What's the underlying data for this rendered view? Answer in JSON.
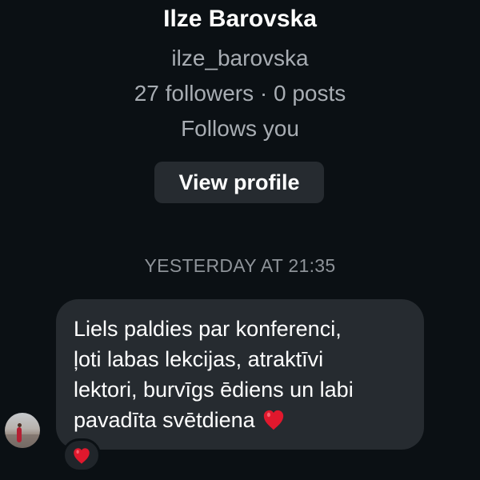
{
  "profile": {
    "name": "Ilze Barovska",
    "username": "ilze_barovska",
    "stats": "27 followers · 0 posts",
    "follows_you": "Follows you",
    "view_profile_button": "View profile"
  },
  "conversation": {
    "timestamp": "YESTERDAY AT 21:35",
    "message_lines": [
      "Liels paldies par konferenci,",
      "ļoti labas lekcijas, atraktīvi",
      "lektori, burvīgs ēdiens un labi",
      "pavadīta svētdiena"
    ],
    "inline_emoji_icon": "red-heart-icon",
    "reaction_icon": "red-heart-icon"
  },
  "colors": {
    "background": "#0b1014",
    "bubble": "#262b30",
    "secondary_text": "#a8adb3",
    "heart": "#e0182d"
  }
}
